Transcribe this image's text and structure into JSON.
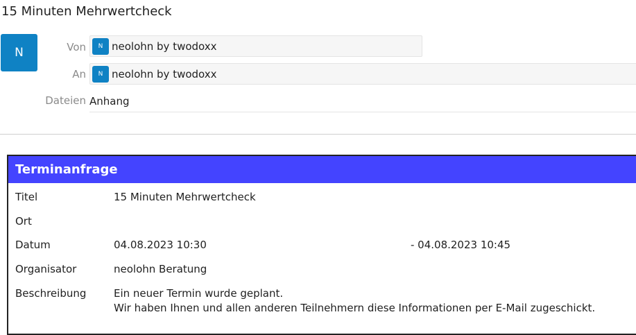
{
  "message": {
    "subject": "15 Minuten Mehrwertcheck",
    "sender_avatar_initial": "N",
    "from_label": "Von",
    "from_avatar_initial": "N",
    "from_name": "neolohn by twodoxx",
    "to_label": "An",
    "to_avatar_initial": "N",
    "to_name": "neolohn by twodoxx",
    "files_label": "Dateien",
    "files_value": "Anhang"
  },
  "appointment": {
    "header": "Terminanfrage",
    "title_label": "Titel",
    "title_value": "15 Minuten Mehrwertcheck",
    "location_label": "Ort",
    "location_value": "",
    "date_label": "Datum",
    "date_start": "04.08.2023 10:30",
    "date_end": "- 04.08.2023 10:45",
    "organizer_label": "Organisator",
    "organizer_value": "neolohn Beratung",
    "description_label": "Beschreibung",
    "description_line1": "Ein neuer Termin wurde geplant.",
    "description_line2": "Wir haben Ihnen und allen anderen Teilnehmern diese Informationen per E-Mail zugeschickt."
  },
  "colors": {
    "avatar": "#0f82c4",
    "card_header": "#4444ff"
  }
}
